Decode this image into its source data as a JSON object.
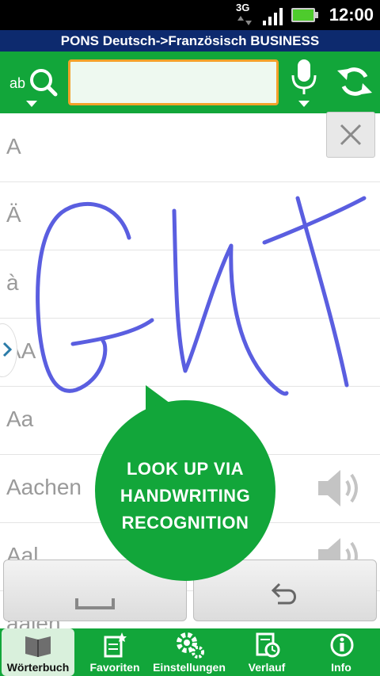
{
  "status": {
    "network": "3G",
    "time": "12:00"
  },
  "app": {
    "title": "PONS Deutsch->Französisch BUSINESS"
  },
  "toolbar": {
    "search_value": "",
    "keyboard_icon": "abc-search-icon",
    "mic_icon": "microphone-icon",
    "sync_icon": "sync-icon"
  },
  "entries": [
    {
      "label": "A",
      "audio": false
    },
    {
      "label": "Ä",
      "audio": false
    },
    {
      "label": "à",
      "audio": false
    },
    {
      "label": "AA",
      "audio": false
    },
    {
      "label": "Aa",
      "audio": false
    },
    {
      "label": "Aachen",
      "audio": true
    },
    {
      "label": "Aal",
      "audio": true
    },
    {
      "label": "aalen",
      "audio": false
    }
  ],
  "handwriting": {
    "text": "GUT"
  },
  "promo": {
    "line1": "LOOK UP VIA",
    "line2": "HANDWRITING",
    "line3": "RECOGNITION"
  },
  "keys": {
    "space_icon": "space-icon",
    "undo_icon": "undo-icon"
  },
  "nav": [
    {
      "label": "Wörterbuch",
      "icon": "book-icon",
      "active": true
    },
    {
      "label": "Favoriten",
      "icon": "favorites-icon",
      "active": false
    },
    {
      "label": "Einstellungen",
      "icon": "settings-icon",
      "active": false
    },
    {
      "label": "Verlauf",
      "icon": "history-icon",
      "active": false
    },
    {
      "label": "Info",
      "icon": "info-icon",
      "active": false
    }
  ],
  "colors": {
    "brand_green": "#12a63a",
    "title_blue": "#0d2a6e",
    "ink": "#5a5ee0",
    "search_border": "#f3a12a"
  }
}
